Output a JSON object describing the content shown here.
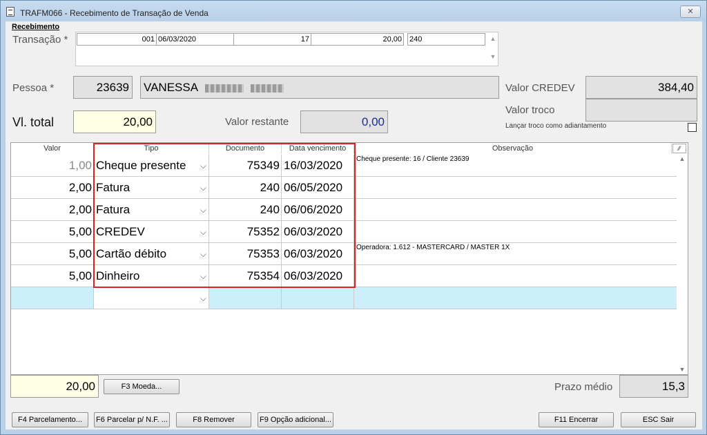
{
  "window": {
    "title": "TRAFM066 - Recebimento de Transação de Venda",
    "close_label": "✕"
  },
  "section_title": "Recebimento",
  "transacao": {
    "label": "Transação *",
    "fields": [
      "001",
      "06/03/2020",
      "17",
      "20,00",
      "240"
    ]
  },
  "pessoa": {
    "label": "Pessoa *",
    "code": "23639",
    "name": "VANESSA"
  },
  "valor_credev": {
    "label": "Valor CREDEV",
    "value": "384,40"
  },
  "valor_troco": {
    "label": "Valor troco",
    "value": ""
  },
  "troco_adiantamento": {
    "label": "Lançar troco como adiantamento",
    "checked": false
  },
  "vl_total": {
    "label": "Vl. total",
    "value": "20,00"
  },
  "valor_restante": {
    "label": "Valor restante",
    "value": "0,00"
  },
  "grid": {
    "columns": [
      "Valor",
      "Tipo",
      "Documento",
      "Data vencimento",
      "Observação"
    ],
    "rows": [
      {
        "valor": "1,00",
        "tipo": "Cheque presente",
        "documento": "75349",
        "vencimento": "16/03/2020",
        "observacao": "Cheque presente: 16 / Cliente 23639"
      },
      {
        "valor": "2,00",
        "tipo": "Fatura",
        "documento": "240",
        "vencimento": "06/05/2020",
        "observacao": ""
      },
      {
        "valor": "2,00",
        "tipo": "Fatura",
        "documento": "240",
        "vencimento": "06/06/2020",
        "observacao": ""
      },
      {
        "valor": "5,00",
        "tipo": "CREDEV",
        "documento": "75352",
        "vencimento": "06/03/2020",
        "observacao": ""
      },
      {
        "valor": "5,00",
        "tipo": "Cartão débito",
        "documento": "75353",
        "vencimento": "06/03/2020",
        "observacao": "Operadora: 1.612 - MASTERCARD / MASTER 1X"
      },
      {
        "valor": "5,00",
        "tipo": "Dinheiro",
        "documento": "75354",
        "vencimento": "06/03/2020",
        "observacao": ""
      }
    ],
    "dropdown_glyph": "⌵",
    "scroll_up": "▲",
    "scroll_down": "▼",
    "header_button": "⁄⁄"
  },
  "footer": {
    "total": "20,00",
    "moeda_button": "F3 Moeda...",
    "prazo_label": "Prazo médio",
    "prazo_value": "15,3"
  },
  "buttons": {
    "f4": "F4 Parcelamento...",
    "f6": "F6 Parcelar p/ N.F. ...",
    "f8": "F8 Remover",
    "f9": "F9 Opção adicional...",
    "f11": "F11 Encerrar",
    "esc": "ESC Sair"
  },
  "colors": {
    "highlight": "#e02020",
    "new_row": "#cdeffc",
    "total_bg": "#ffffe6",
    "restante_text": "#1a2a9a"
  }
}
